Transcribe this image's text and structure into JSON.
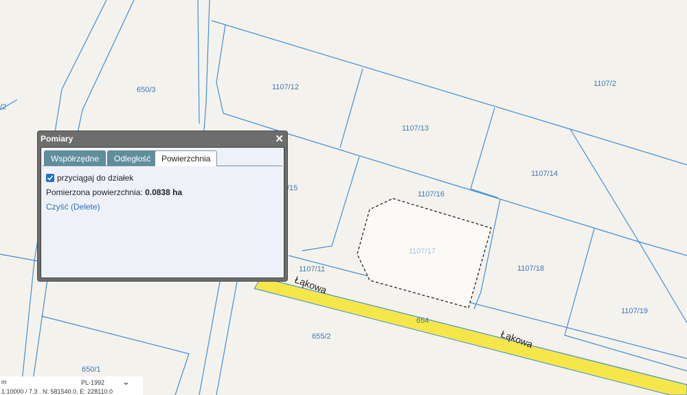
{
  "map": {
    "parcels": {
      "p_650_3": "650/3",
      "p_1107_12": "1107/12",
      "p_1107_2": "1107/2",
      "p_1107_13": "1107/13",
      "p_1107_14": "1107/14",
      "p_1107_15": "/15",
      "p_1107_16": "1107/16",
      "p_1107_17": "1107/17",
      "p_1107_18": "1107/18",
      "p_1107_11": "1107/11",
      "p_1107_19": "1107/19",
      "p_655_2": "655/2",
      "p_650_1": "650/1",
      "p_edge_2": "/2"
    },
    "road": {
      "name_1": "Łąkowa",
      "name_2": "Łąkowa",
      "number": "654",
      "fill_color": "#f5e64a"
    },
    "boundary_color": "#3d8fd6",
    "measurement_polygon_color": "#222222"
  },
  "panel": {
    "title": "Pomiary",
    "close_icon": "close-icon",
    "tabs": [
      "Współrzędne",
      "Odległość",
      "Powierzchnia"
    ],
    "active_tab": "Powierzchnia",
    "snap_checkbox": {
      "label": "przyciągaj do działek",
      "checked": true
    },
    "area_label": "Pomierzona powierzchnia: ",
    "area_value": "0.0838 ha",
    "clear_link": "Czyść (Delete)"
  },
  "status_bar": {
    "scale": "m",
    "crs": "PL-1992",
    "coords": "1:10000 / 7.3 . N: 581540.0, E: 228110.0"
  }
}
